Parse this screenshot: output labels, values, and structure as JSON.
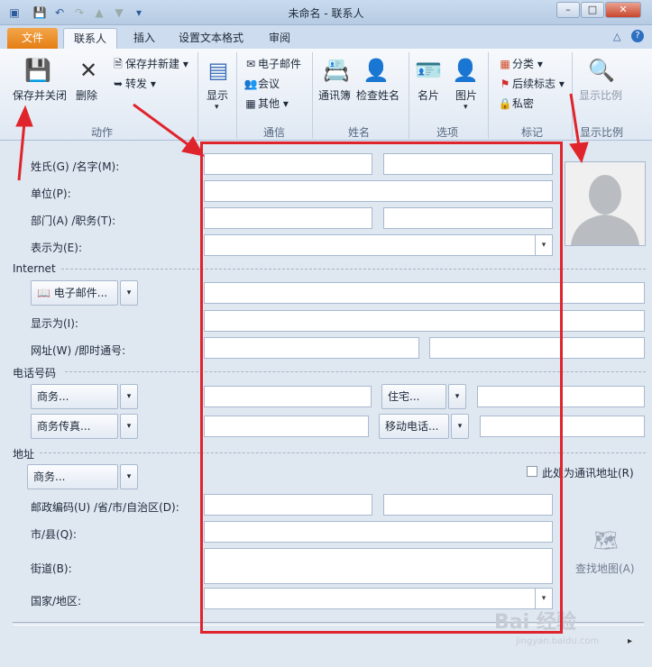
{
  "window": {
    "title": "未命名 - 联系人",
    "minimize": "–",
    "maximize": "□",
    "close": "✕"
  },
  "tabs": [
    {
      "label": "文件"
    },
    {
      "label": "联系人"
    },
    {
      "label": "插入"
    },
    {
      "label": "设置文本格式"
    },
    {
      "label": "审阅"
    }
  ],
  "ribbon": {
    "actions": {
      "group": "动作",
      "save_close": "保存并关闭",
      "delete": "删除",
      "save_new": "保存并新建",
      "forward": "转发"
    },
    "show": {
      "label": "显示"
    },
    "communicate": {
      "group": "通信",
      "email": "电子邮件",
      "meeting": "会议",
      "more": "其他"
    },
    "names": {
      "group": "姓名",
      "address_book": "通讯簿",
      "check_names": "检查姓名"
    },
    "options": {
      "group": "选项",
      "business_card": "名片",
      "picture": "图片"
    },
    "tags": {
      "group": "标记",
      "categorize": "分类",
      "follow_up": "后续标志",
      "private": "私密"
    },
    "zoom": {
      "group": "显示比例",
      "label": "显示比例"
    }
  },
  "form": {
    "name_label": "姓氏(G)  /名字(M):",
    "company_label": "单位(P):",
    "dept_label": "部门(A)  /职务(T):",
    "file_as_label": "表示为(E):",
    "internet_section": "Internet",
    "email_button": "电子邮件...",
    "display_as_label": "显示为(I):",
    "web_label": "网址(W)  /即时通号:",
    "phone_section": "电话号码",
    "business_button": "商务...",
    "home_button": "住宅...",
    "business_fax_button": "商务传真...",
    "mobile_button": "移动电话...",
    "address_section": "地址",
    "address_type_button": "商务...",
    "mailing_checkbox": "此处为通讯地址(R)",
    "zip_label": "邮政编码(U)  /省/市/自治区(D):",
    "city_label": "市/县(Q):",
    "street_label": "街道(B):",
    "country_label": "国家/地区:",
    "map_label": "查找地图(A)"
  },
  "watermark": {
    "brand": "Bai 经验",
    "url": "jingyan.baidu.com"
  },
  "colors": {
    "highlight": "#e0242c",
    "file_tab": "#e47e15"
  }
}
